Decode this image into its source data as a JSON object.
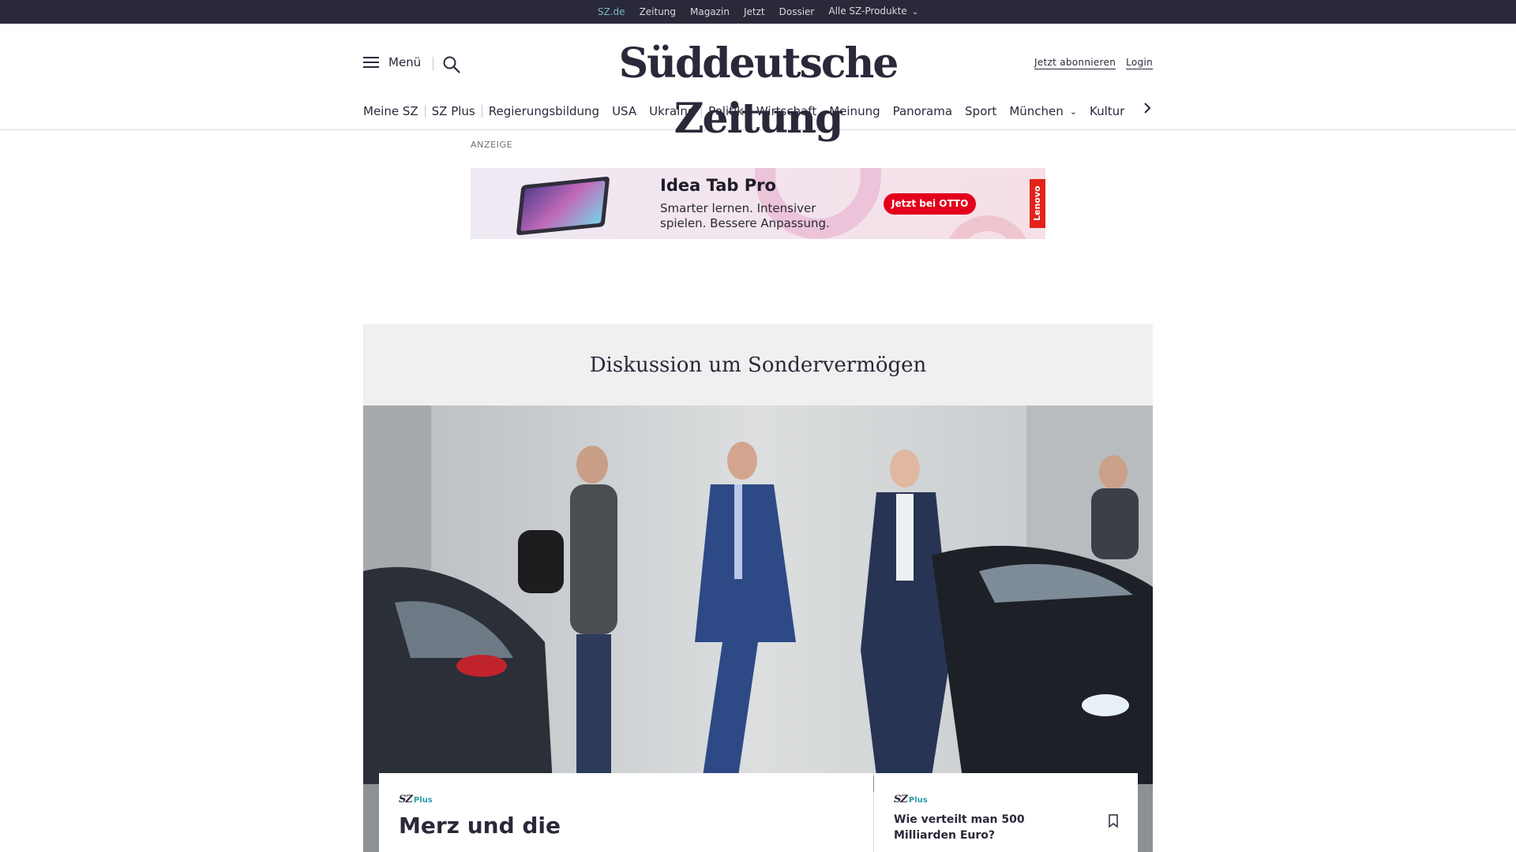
{
  "topbar": {
    "links": [
      {
        "label": "SZ.de",
        "active": true
      },
      {
        "label": "Zeitung"
      },
      {
        "label": "Magazin"
      },
      {
        "label": "Jetzt"
      },
      {
        "label": "Dossier"
      },
      {
        "label": "Alle SZ-Produkte",
        "dropdown": true
      }
    ],
    "background": "#29293a",
    "active_color": "#7fb8c4"
  },
  "header": {
    "menu_label": "Menü",
    "logo": "Süddeutsche Zeitung",
    "subscribe_label": "Jetzt abonnieren",
    "login_label": "Login"
  },
  "nav": {
    "items": [
      "Meine SZ",
      "SZ Plus",
      "Regierungsbildung",
      "USA",
      "Ukraine",
      "Politik",
      "Wirtschaft",
      "Meinung",
      "Panorama",
      "Sport",
      "München",
      "Kultur"
    ]
  },
  "ad": {
    "label": "ANZEIGE",
    "title": "Idea Tab Pro",
    "subtitle": "Smarter lernen. Intensiver spielen. Bessere Anpassung.",
    "cta": "Jetzt bei OTTO",
    "brand": "Lenovo"
  },
  "teaser": {
    "topic": "Diskussion um Sondervermögen",
    "main_badge": {
      "sz": "SZ",
      "plus": "Plus"
    },
    "main_headline": "Merz und die",
    "side_badge": {
      "sz": "SZ",
      "plus": "Plus"
    },
    "side_headline": "Wie verteilt man 500 Milliarden Euro?"
  }
}
